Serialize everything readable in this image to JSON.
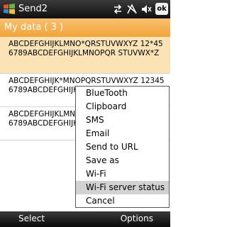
{
  "titlebar": {
    "app_title": "Send2",
    "ok_label": "ok",
    "icons": [
      "start-logo-icon",
      "data-connection-icon",
      "signal-off-icon",
      "volume-icon"
    ]
  },
  "header": {
    "title": "My data ( 3 )"
  },
  "list": {
    "items": [
      {
        "text": "ABCDEFGHIJKLMNO*QRSTUVWXYZ 12*456789ABCDEFGHIJKLMNOPQR STUVWX*Z",
        "selected": true
      },
      {
        "text": "ABCDEFGHIJK*MNOPQRSTUVWXYZ 123456789ABCDEFGHIJKLMNOPQR S*UVWXYZ",
        "selected": false
      },
      {
        "text": "ABCDEFGHIJKLMNOPQRSTUVWXYZ 123456789ABCDEFGHIJKLMNOPQR ST*VWXYZ",
        "selected": false
      }
    ]
  },
  "menu": {
    "items": [
      {
        "label": "BlueTooth",
        "highlighted": false
      },
      {
        "label": "Clipboard",
        "highlighted": false
      },
      {
        "label": "SMS",
        "highlighted": false
      },
      {
        "label": "Email",
        "highlighted": false
      },
      {
        "label": "Send to URL",
        "highlighted": false
      },
      {
        "label": "Save as",
        "highlighted": false
      },
      {
        "label": "Wi-Fi",
        "highlighted": false
      },
      {
        "label": "Wi-Fi server status",
        "highlighted": true
      },
      {
        "label": "Cancel",
        "highlighted": false
      }
    ]
  },
  "softkeys": {
    "left": "Select",
    "right": "Options"
  },
  "colors": {
    "header": "#f1a43b",
    "selected_row": "#fbe3b5",
    "menu_highlight": "#d2d2d2",
    "titlebar": "#101010"
  }
}
